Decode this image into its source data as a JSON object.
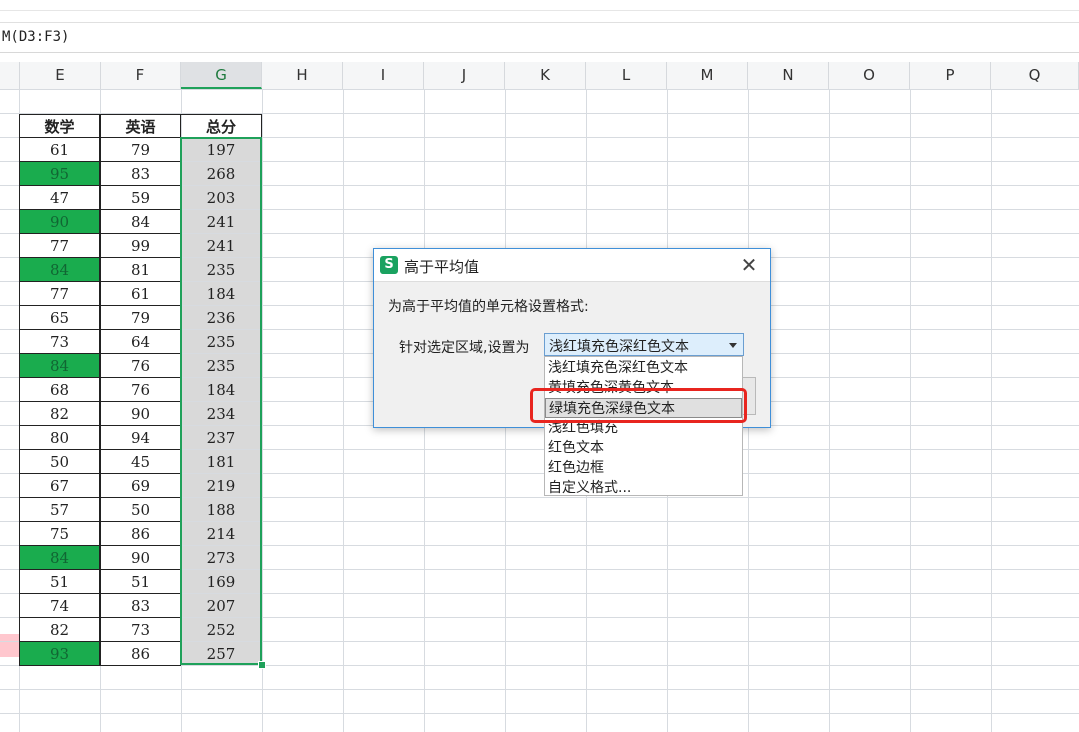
{
  "formula_bar": {
    "text": "M(D3:F3)"
  },
  "columns": [
    "E",
    "F",
    "G",
    "H",
    "I",
    "J",
    "K",
    "L",
    "M",
    "N",
    "O",
    "P",
    "Q"
  ],
  "table": {
    "headers": [
      "数学",
      "英语",
      "总分"
    ],
    "rows": [
      {
        "math": "61",
        "english": "79",
        "total": "197",
        "math_green": false
      },
      {
        "math": "95",
        "english": "83",
        "total": "268",
        "math_green": true
      },
      {
        "math": "47",
        "english": "59",
        "total": "203",
        "math_green": false
      },
      {
        "math": "90",
        "english": "84",
        "total": "241",
        "math_green": true
      },
      {
        "math": "77",
        "english": "99",
        "total": "241",
        "math_green": false
      },
      {
        "math": "84",
        "english": "81",
        "total": "235",
        "math_green": true
      },
      {
        "math": "77",
        "english": "61",
        "total": "184",
        "math_green": false
      },
      {
        "math": "65",
        "english": "79",
        "total": "236",
        "math_green": false
      },
      {
        "math": "73",
        "english": "64",
        "total": "235",
        "math_green": false
      },
      {
        "math": "84",
        "english": "76",
        "total": "235",
        "math_green": true
      },
      {
        "math": "68",
        "english": "76",
        "total": "184",
        "math_green": false
      },
      {
        "math": "82",
        "english": "90",
        "total": "234",
        "math_green": false
      },
      {
        "math": "80",
        "english": "94",
        "total": "237",
        "math_green": false
      },
      {
        "math": "50",
        "english": "45",
        "total": "181",
        "math_green": false
      },
      {
        "math": "67",
        "english": "69",
        "total": "219",
        "math_green": false
      },
      {
        "math": "57",
        "english": "50",
        "total": "188",
        "math_green": false
      },
      {
        "math": "75",
        "english": "86",
        "total": "214",
        "math_green": false
      },
      {
        "math": "84",
        "english": "90",
        "total": "273",
        "math_green": true
      },
      {
        "math": "51",
        "english": "51",
        "total": "169",
        "math_green": false
      },
      {
        "math": "74",
        "english": "83",
        "total": "207",
        "math_green": false
      },
      {
        "math": "82",
        "english": "73",
        "total": "252",
        "math_green": false
      },
      {
        "math": "93",
        "english": "86",
        "total": "257",
        "math_green": true
      }
    ]
  },
  "dialog": {
    "title": "高于平均值",
    "icon_letter": "S",
    "close_glyph": "✕",
    "description": "为高于平均值的单元格设置格式:",
    "label": "针对选定区域,设置为",
    "selected": "浅红填充色深红色文本",
    "options": [
      "浅红填充色深红色文本",
      "黄填充色深黄色文本",
      "绿填充色深绿色文本",
      "浅红色填充",
      "红色文本",
      "红色边框",
      "自定义格式..."
    ],
    "highlighted_index": 2
  },
  "colors": {
    "green_fill": "#1aac4e",
    "gray_fill": "#d9d9d9",
    "selection": "#1fa15a",
    "annotation_red": "#e8251f"
  }
}
